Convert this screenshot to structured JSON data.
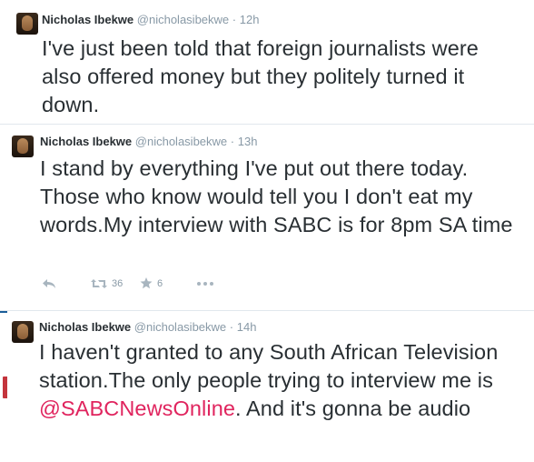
{
  "tweets": [
    {
      "name": "Nicholas Ibekwe",
      "handle": "@nicholasibekwe",
      "dot": "·",
      "time": "12h",
      "text": "I've just been told that foreign journalists were also offered money but they politely turned it down."
    },
    {
      "name": "Nicholas Ibekwe",
      "handle": "@nicholasibekwe",
      "dot": "·",
      "time": "13h",
      "text": "I stand by everything I've put out there today. Those who know would tell you I don't eat my words.My interview with SABC is for 8pm SA time",
      "retweets": "36",
      "favorites": "6"
    },
    {
      "name": "Nicholas Ibekwe",
      "handle": "@nicholasibekwe",
      "dot": "·",
      "time": "14h",
      "text_before": "I haven't granted to any South African Television station.The only people trying to interview me is ",
      "mention": "@SABCNewsOnline",
      "text_after": ". And it's gonna be audio"
    }
  ],
  "icons": {
    "reply": "reply-icon",
    "retweet": "retweet-icon",
    "favorite": "star-icon",
    "more": "more-icon"
  },
  "colors": {
    "name": "#292f33",
    "meta": "#8899a6",
    "mention": "#e0245e",
    "action": "#a8b5bf"
  }
}
